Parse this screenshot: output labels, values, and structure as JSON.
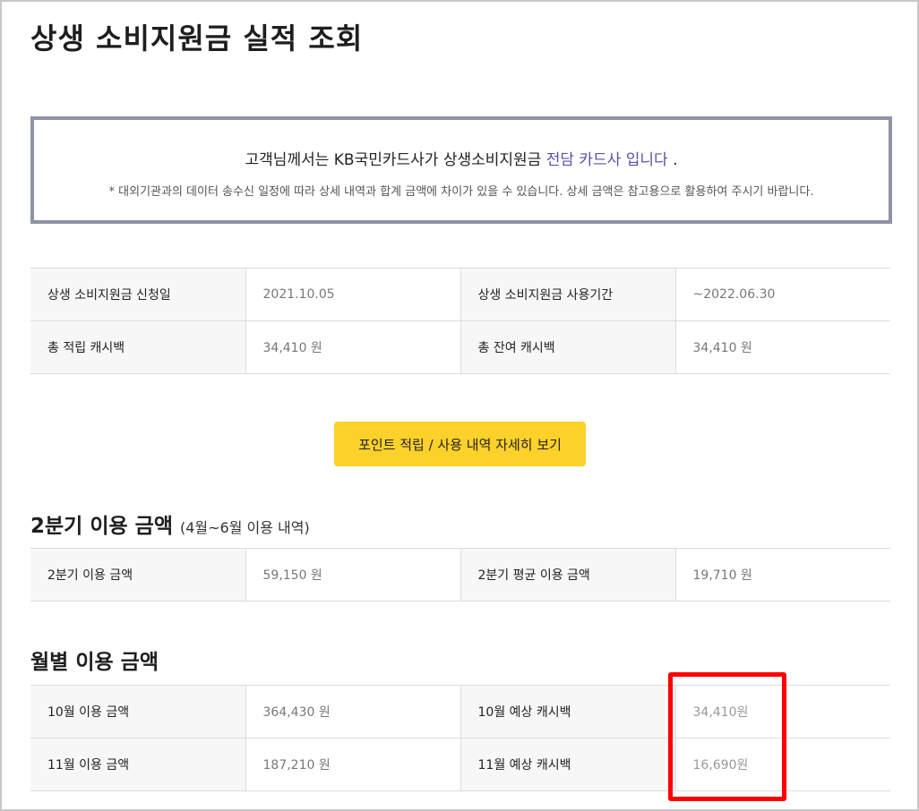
{
  "page_title": "상생 소비지원금 실적 조회",
  "notice": {
    "main_prefix": "고객님께서는 KB국민카드사가 상생소비지원금",
    "main_accent": "전담 카드사 입니다",
    "main_suffix": ".",
    "sub": "* 대외기관과의 데이터 송수신 일정에 따라 상세 내역과 합계 금액에 차이가 있을 수 있습니다. 상세 금액은 참고용으로 활용하여 주시기 바랍니다."
  },
  "summary": {
    "apply_date_label": "상생 소비지원금 신청일",
    "apply_date_value": "2021.10.05",
    "period_label": "상생 소비지원금 사용기간",
    "period_value": "~2022.06.30",
    "total_cashback_label": "총 적립 캐시백",
    "total_cashback_value": "34,410 원",
    "remaining_cashback_label": "총 잔여 캐시백",
    "remaining_cashback_value": "34,410 원"
  },
  "detail_button_label": "포인트 적립 / 사용 내역 자세히 보기",
  "quarter": {
    "title": "2분기 이용 금액",
    "title_sub": "(4월~6월 이용 내역)",
    "amount_label": "2분기 이용 금액",
    "amount_value": "59,150 원",
    "avg_label": "2분기 평균 이용 금액",
    "avg_value": "19,710 원"
  },
  "monthly": {
    "title": "월별 이용 금액",
    "rows": [
      {
        "usage_label": "10월 이용 금액",
        "usage_value": "364,430 원",
        "cashback_label": "10월 예상 캐시백",
        "cashback_value": "34,410원"
      },
      {
        "usage_label": "11월 이용 금액",
        "usage_value": "187,210 원",
        "cashback_label": "11월 예상 캐시백",
        "cashback_value": "16,690원"
      }
    ]
  },
  "colors": {
    "accent": "#5b4fa8",
    "button": "#fcd12a",
    "highlight": "#ff0000",
    "notice_border": "#8e93a6"
  }
}
